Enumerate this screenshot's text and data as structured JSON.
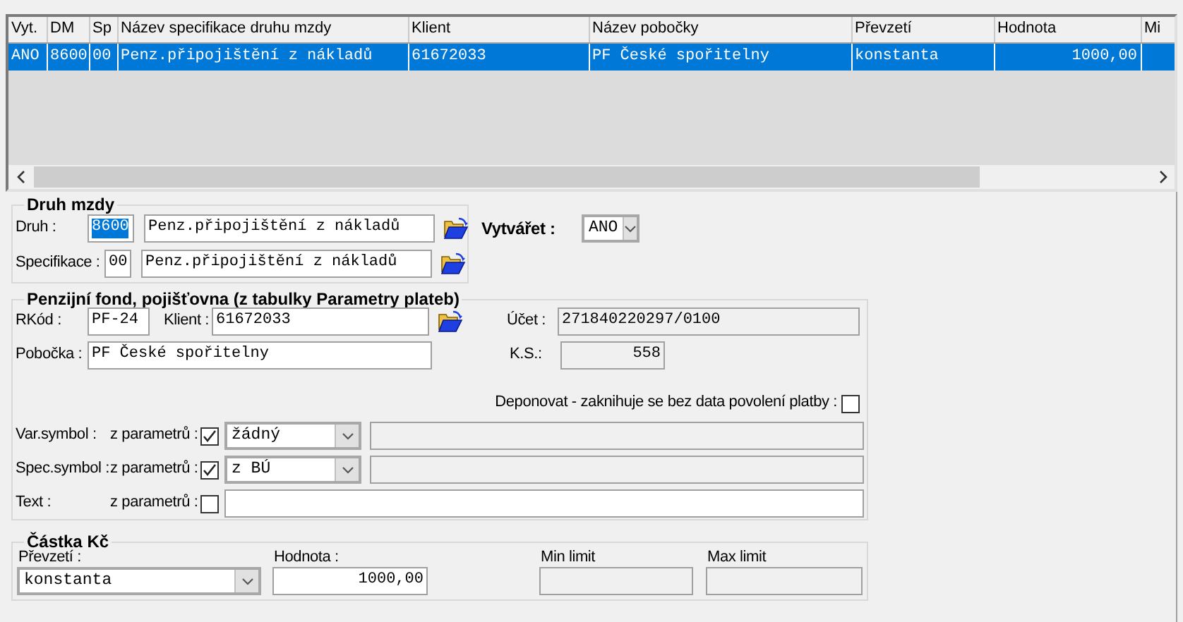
{
  "table": {
    "columns": [
      "Vyt.",
      "DM",
      "Sp",
      "Název specifikace druhu mzdy",
      "Klient",
      "Název pobočky",
      "Převzetí",
      "Hodnota",
      "Mi"
    ],
    "rows": [
      {
        "selected": true,
        "cells": [
          "ANO",
          "8600",
          "00",
          "Penz.připojištění z nákladů",
          "61672033",
          "PF České spořitelny",
          "konstanta",
          "1000,00"
        ]
      }
    ]
  },
  "druh_mzdy": {
    "title": "Druh mzdy",
    "druh": {
      "label": "Druh :",
      "code": "8600",
      "code_selected": true,
      "name": "Penz.připojištění z nákladů"
    },
    "specifikace": {
      "label": "Specifikace :",
      "code": "00",
      "code_selected": false,
      "name": "Penz.připojištění z nákladů"
    }
  },
  "vytvaret": {
    "label": "Vytvářet :",
    "value": "ANO"
  },
  "penzijni_fond": {
    "title": "Penzijní fond, pojišťovna (z tabulky Parametry plateb)",
    "rkod": {
      "label": "RKód :",
      "value": "PF-24"
    },
    "klient": {
      "label": "Klient :",
      "value": "61672033"
    },
    "ucet": {
      "label": "Účet :",
      "value": "271840220297/0100"
    },
    "pobocka": {
      "label": "Pobočka :",
      "value": "PF České spořitelny"
    },
    "ks": {
      "label": "K.S.:",
      "value": "558"
    },
    "deponovat": {
      "label": "Deponovat - zaknihuje se bez data povolení platby :",
      "checked": false
    },
    "symbols": [
      {
        "kind": "select",
        "label": "Var.symbol :",
        "from_label": "z parametrů :",
        "checked": true,
        "value": "žádný"
      },
      {
        "kind": "select",
        "label": "Spec.symbol :",
        "from_label": "z parametrů :",
        "checked": true,
        "value": "z BÚ"
      },
      {
        "kind": "text",
        "label": "Text :",
        "from_label": "z parametrů :",
        "checked": false
      }
    ]
  },
  "castka": {
    "title": "Částka Kč",
    "prevzeti": {
      "label": "Převzetí :",
      "value": "konstanta"
    },
    "hodnota": {
      "label": "Hodnota :",
      "value": "1000,00"
    },
    "min_limit": {
      "label": "Min limit"
    },
    "max_limit": {
      "label": "Max limit"
    }
  }
}
